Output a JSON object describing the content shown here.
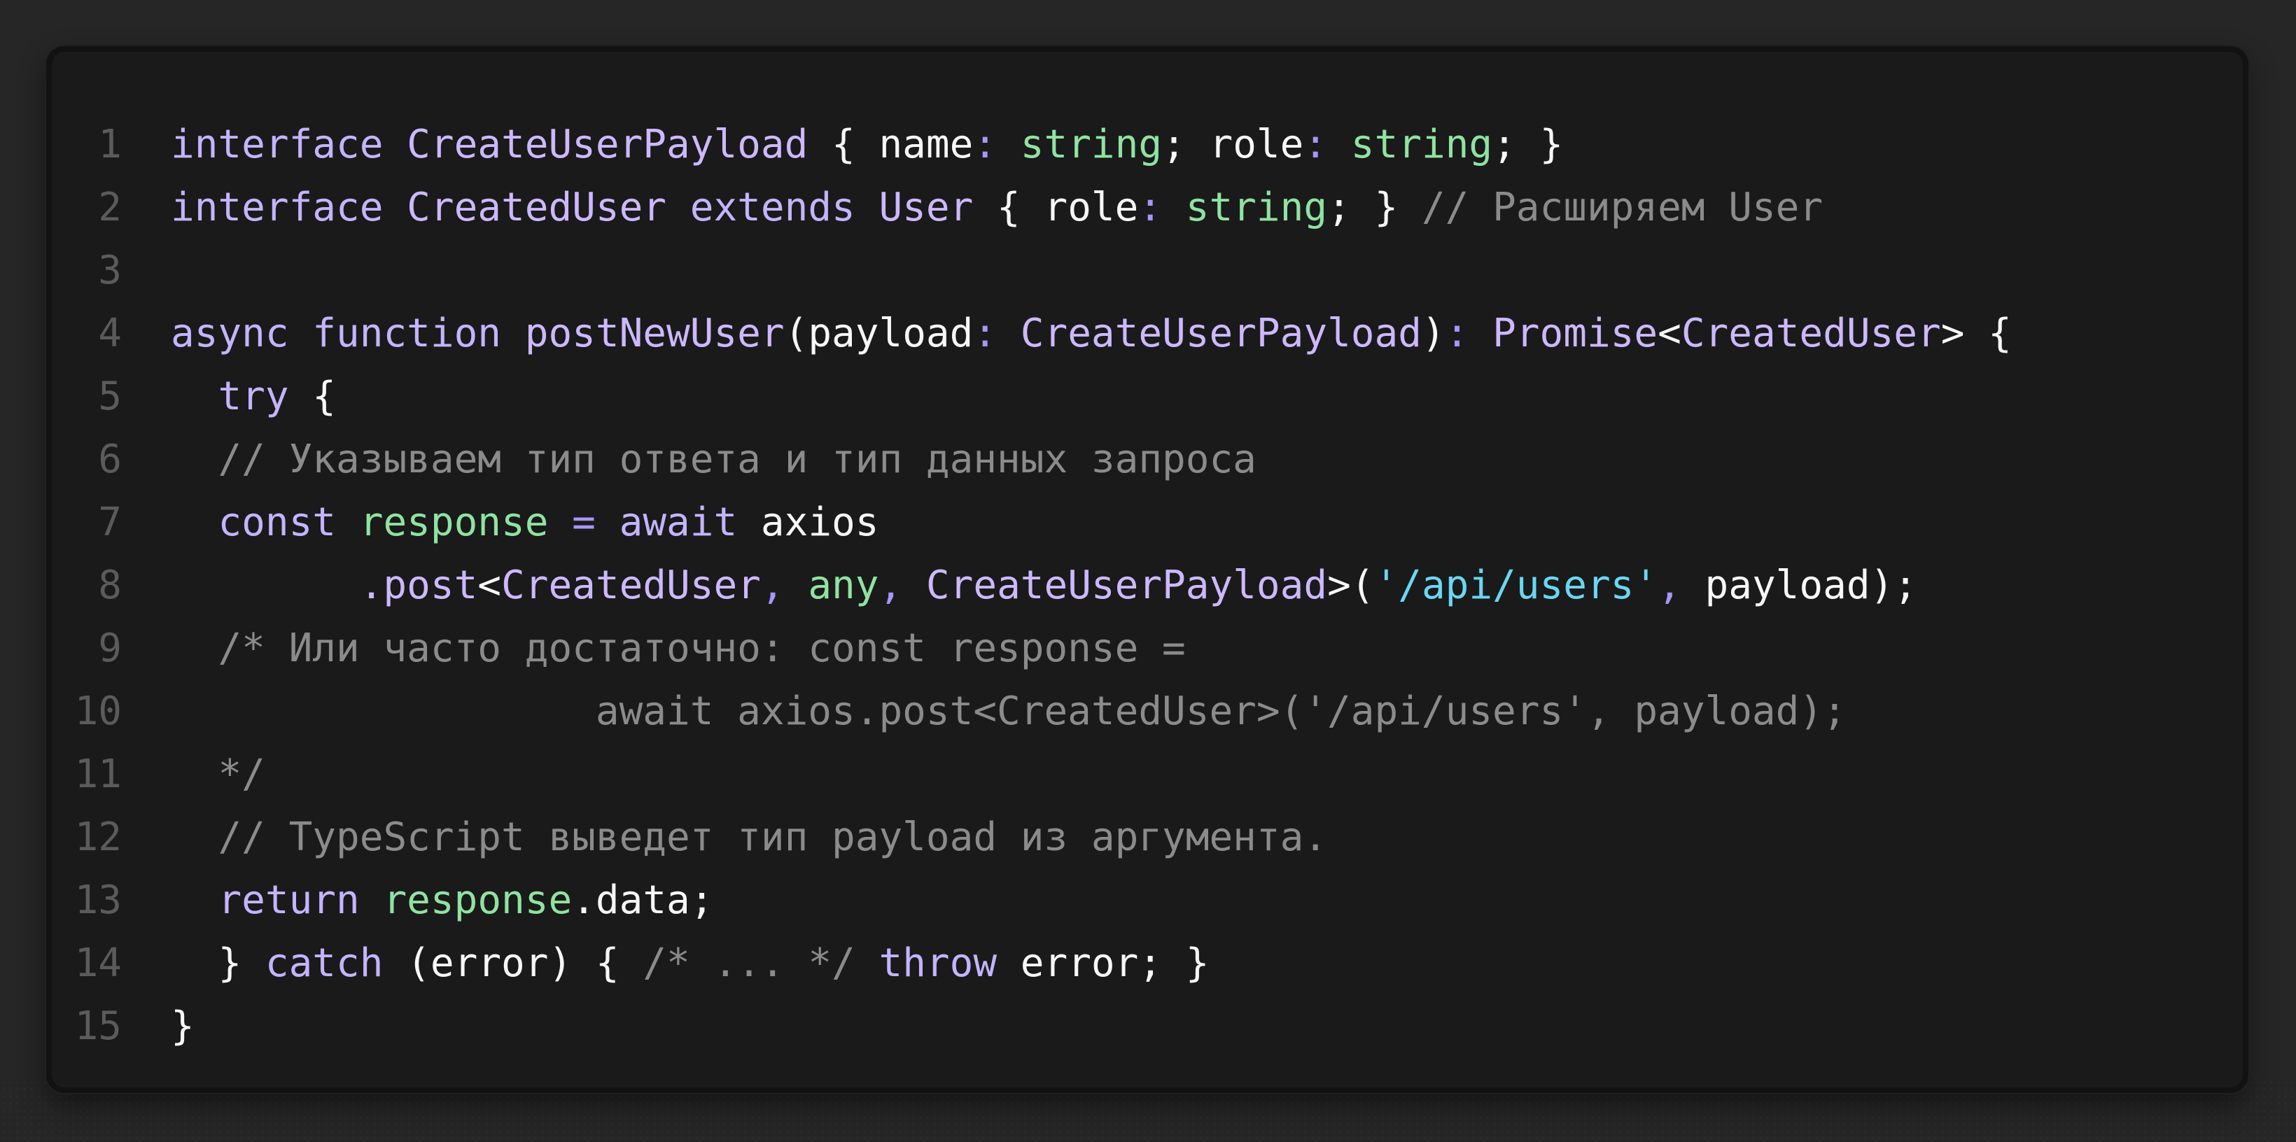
{
  "code_lines": [
    "1",
    "2",
    "3",
    "4",
    "5",
    "6",
    "7",
    "8",
    "9",
    "10",
    "11",
    "12",
    "13",
    "14",
    "15"
  ],
  "code": {
    "line1": [
      {
        "text": "interface ",
        "kind": "kw"
      },
      {
        "text": "CreateUserPayload",
        "kind": "type"
      },
      {
        "text": " { ",
        "kind": "plain"
      },
      {
        "text": "name",
        "kind": "plain"
      },
      {
        "text": ": ",
        "kind": "op"
      },
      {
        "text": "string",
        "kind": "grn"
      },
      {
        "text": "; ",
        "kind": "plain"
      },
      {
        "text": "role",
        "kind": "plain"
      },
      {
        "text": ": ",
        "kind": "op"
      },
      {
        "text": "string",
        "kind": "grn"
      },
      {
        "text": "; }",
        "kind": "plain"
      }
    ],
    "line2": [
      {
        "text": "interface ",
        "kind": "kw"
      },
      {
        "text": "CreatedUser",
        "kind": "type"
      },
      {
        "text": " extends ",
        "kind": "kw"
      },
      {
        "text": "User",
        "kind": "type"
      },
      {
        "text": " { ",
        "kind": "plain"
      },
      {
        "text": "role",
        "kind": "plain"
      },
      {
        "text": ": ",
        "kind": "op"
      },
      {
        "text": "string",
        "kind": "grn"
      },
      {
        "text": "; } ",
        "kind": "plain"
      },
      {
        "text": "// Расширяем User",
        "kind": "cmt"
      }
    ],
    "line3": [
      {
        "text": "",
        "kind": "plain"
      }
    ],
    "line4": [
      {
        "text": "async ",
        "kind": "kw"
      },
      {
        "text": "function ",
        "kind": "kw"
      },
      {
        "text": "postNewUser",
        "kind": "type"
      },
      {
        "text": "(",
        "kind": "plain"
      },
      {
        "text": "payload",
        "kind": "plain"
      },
      {
        "text": ": ",
        "kind": "op"
      },
      {
        "text": "CreateUserPayload",
        "kind": "type"
      },
      {
        "text": ")",
        "kind": "plain"
      },
      {
        "text": ": ",
        "kind": "op"
      },
      {
        "text": "Promise",
        "kind": "type"
      },
      {
        "text": "<",
        "kind": "plain"
      },
      {
        "text": "CreatedUser",
        "kind": "type"
      },
      {
        "text": "> {",
        "kind": "plain"
      }
    ],
    "line5": [
      {
        "text": "  ",
        "kind": "plain"
      },
      {
        "text": "try",
        "kind": "kw"
      },
      {
        "text": " {",
        "kind": "plain"
      }
    ],
    "line6": [
      {
        "text": "  ",
        "kind": "plain"
      },
      {
        "text": "// Указываем тип ответа и тип данных запроса",
        "kind": "cmt"
      }
    ],
    "line7": [
      {
        "text": "  ",
        "kind": "plain"
      },
      {
        "text": "const ",
        "kind": "kw"
      },
      {
        "text": "response",
        "kind": "grn"
      },
      {
        "text": " = ",
        "kind": "op"
      },
      {
        "text": "await ",
        "kind": "kw"
      },
      {
        "text": "axios",
        "kind": "plain"
      }
    ],
    "line8": [
      {
        "text": "        ",
        "kind": "plain"
      },
      {
        "text": ".post",
        "kind": "type"
      },
      {
        "text": "<",
        "kind": "plain"
      },
      {
        "text": "CreatedUser",
        "kind": "type"
      },
      {
        "text": ", ",
        "kind": "op"
      },
      {
        "text": "any",
        "kind": "grn"
      },
      {
        "text": ", ",
        "kind": "op"
      },
      {
        "text": "CreateUserPayload",
        "kind": "type"
      },
      {
        "text": ">(",
        "kind": "plain"
      },
      {
        "text": "'/api/users'",
        "kind": "str"
      },
      {
        "text": ", ",
        "kind": "op"
      },
      {
        "text": "payload",
        "kind": "plain"
      },
      {
        "text": ");",
        "kind": "plain"
      }
    ],
    "line9": [
      {
        "text": "  ",
        "kind": "plain"
      },
      {
        "text": "/* Или часто достаточно: const response =",
        "kind": "cmt"
      }
    ],
    "line10": [
      {
        "text": "                  ",
        "kind": "plain"
      },
      {
        "text": "await axios.post<CreatedUser>('/api/users', payload);",
        "kind": "cmt"
      }
    ],
    "line11": [
      {
        "text": "  ",
        "kind": "plain"
      },
      {
        "text": "*/",
        "kind": "cmt"
      }
    ],
    "line12": [
      {
        "text": "  ",
        "kind": "plain"
      },
      {
        "text": "// TypeScript выведет тип payload из аргумента.",
        "kind": "cmt"
      }
    ],
    "line13": [
      {
        "text": "  ",
        "kind": "plain"
      },
      {
        "text": "return ",
        "kind": "kw"
      },
      {
        "text": "response",
        "kind": "grn"
      },
      {
        "text": ".data;",
        "kind": "plain"
      }
    ],
    "line14": [
      {
        "text": "  ",
        "kind": "plain"
      },
      {
        "text": "} ",
        "kind": "plain"
      },
      {
        "text": "catch",
        "kind": "kw"
      },
      {
        "text": " (",
        "kind": "plain"
      },
      {
        "text": "error",
        "kind": "plain"
      },
      {
        "text": ") { ",
        "kind": "plain"
      },
      {
        "text": "/* ... */",
        "kind": "cmt"
      },
      {
        "text": " ",
        "kind": "plain"
      },
      {
        "text": "throw",
        "kind": "kw"
      },
      {
        "text": " error; }",
        "kind": "plain"
      }
    ],
    "line15": [
      {
        "text": "}",
        "kind": "plain"
      }
    ]
  }
}
